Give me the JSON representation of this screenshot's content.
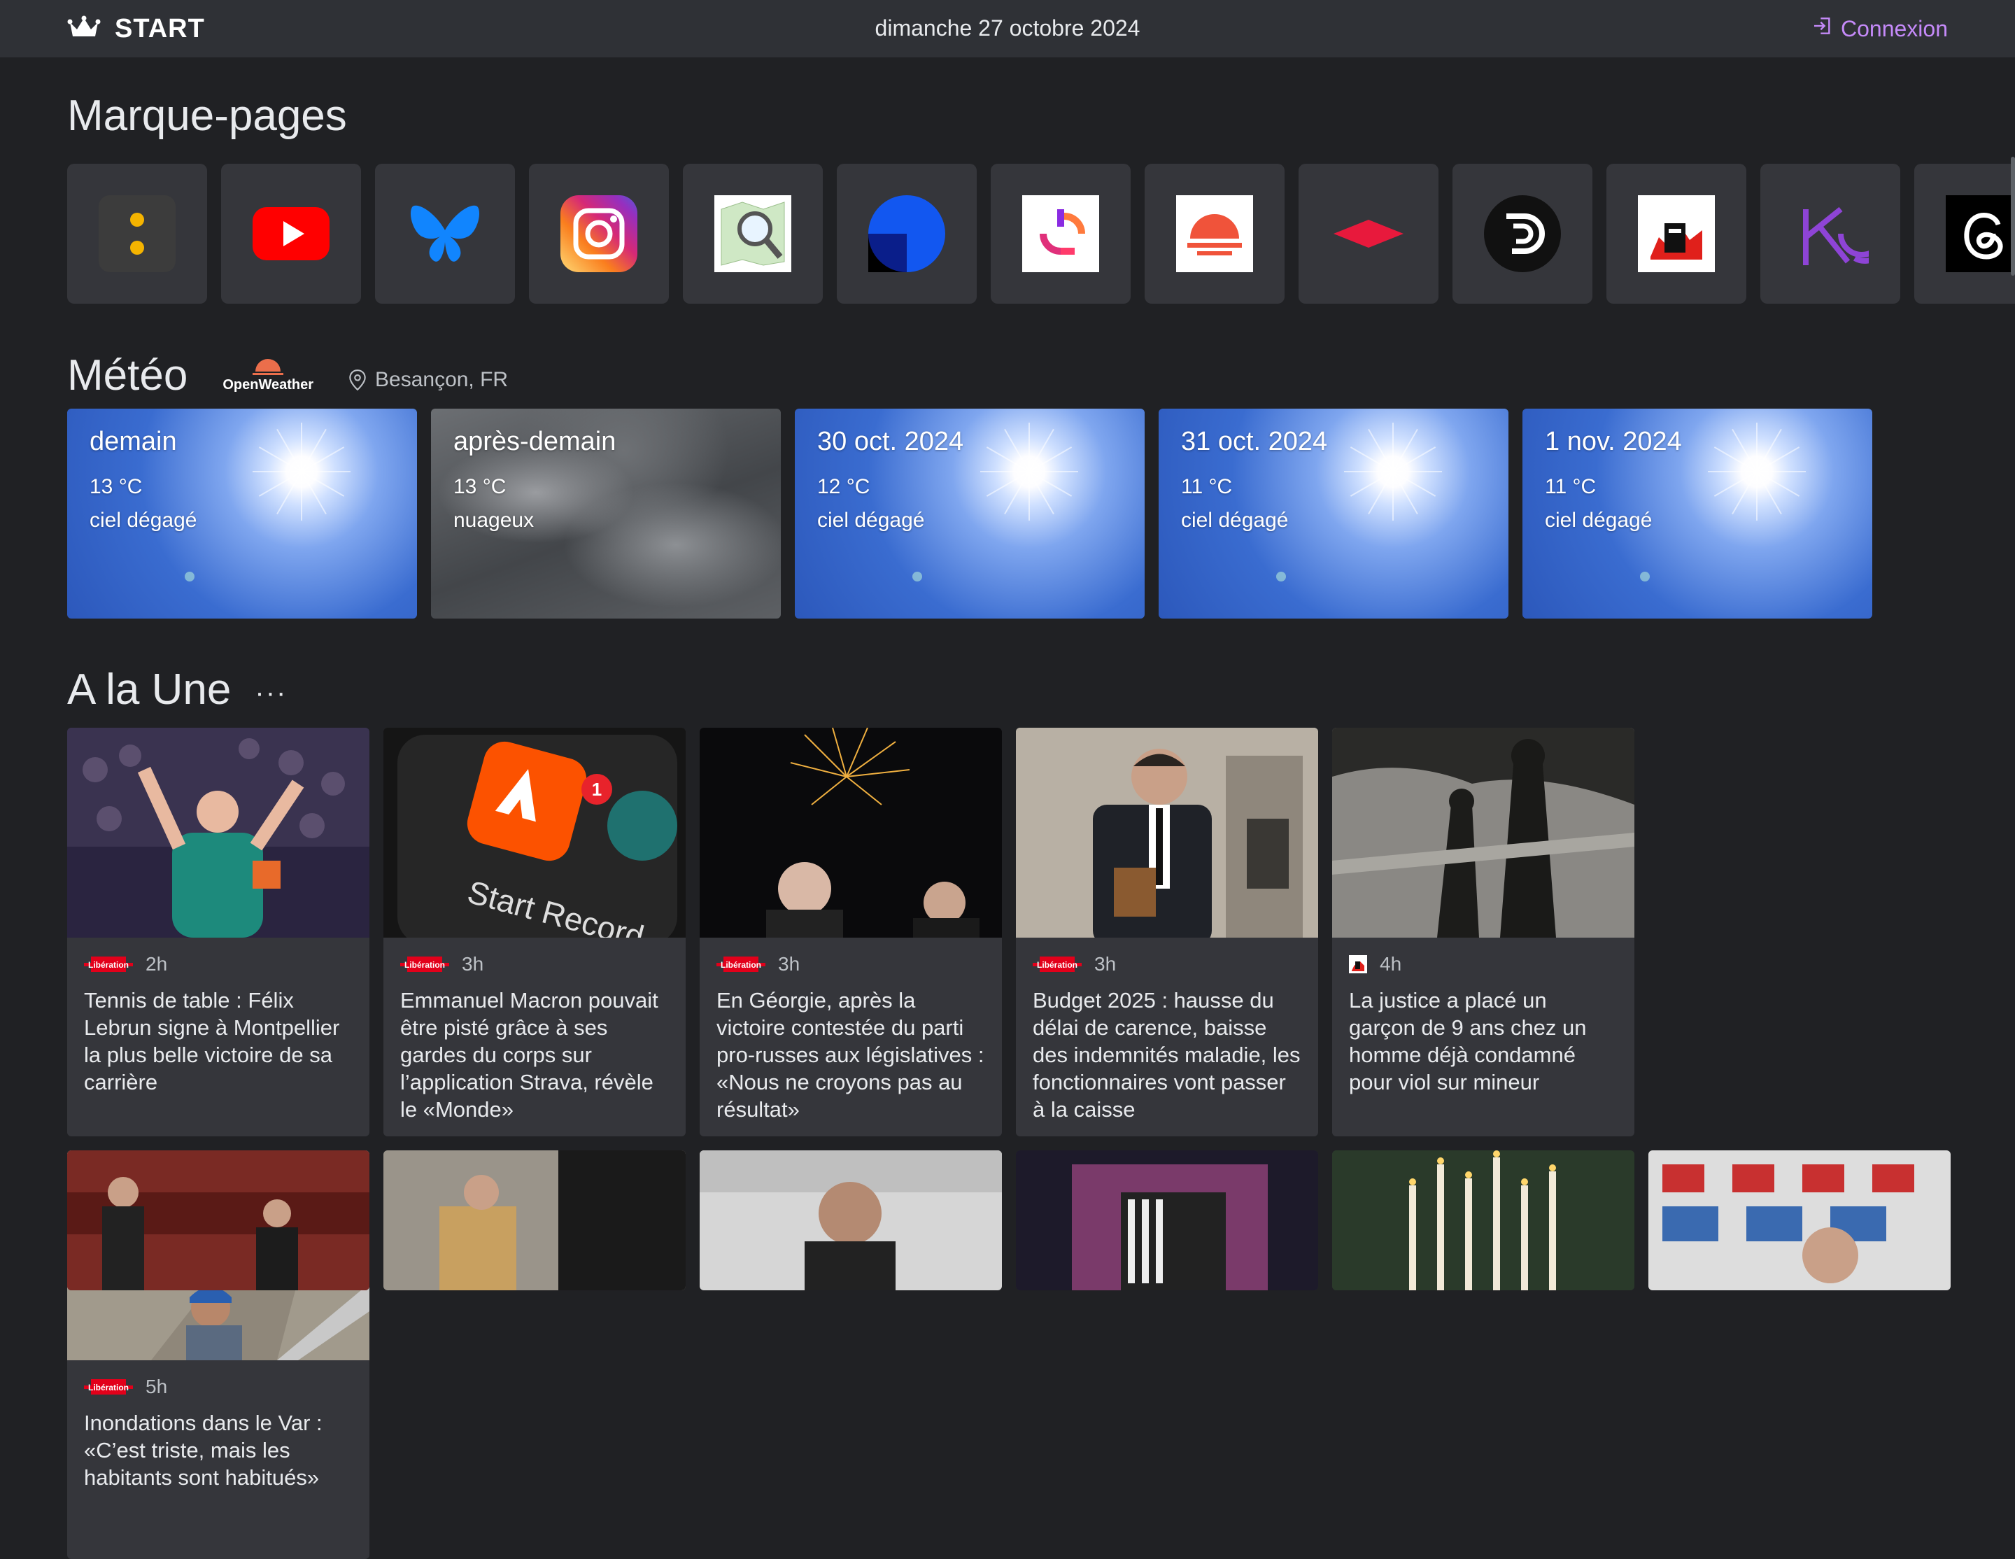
{
  "header": {
    "brand": "START",
    "brand_icon": "crown-icon",
    "date": "dimanche 27 octobre 2024",
    "login_label": "Connexion",
    "login_icon": "login-icon",
    "accent_color": "#c58af9"
  },
  "bookmarks": {
    "title": "Marque-pages",
    "items": [
      {
        "icon": "two-dots-app-icon"
      },
      {
        "icon": "youtube-icon"
      },
      {
        "icon": "bluesky-icon"
      },
      {
        "icon": "instagram-icon"
      },
      {
        "icon": "map-magnifier-icon"
      },
      {
        "icon": "blue-circle-app-icon"
      },
      {
        "icon": "colorful-swirl-app-icon"
      },
      {
        "icon": "sunset-app-icon"
      },
      {
        "icon": "red-diamond-icon"
      },
      {
        "icon": "d-logo-icon"
      },
      {
        "icon": "newspaper-logo-icon"
      },
      {
        "icon": "purple-k-logo-icon"
      },
      {
        "icon": "threads-icon"
      }
    ]
  },
  "weather": {
    "title": "Météo",
    "provider": "OpenWeather",
    "location": "Besançon, FR",
    "days": [
      {
        "day": "demain",
        "temp": "13 °C",
        "desc": "ciel dégagé",
        "kind": "sunny"
      },
      {
        "day": "après-demain",
        "temp": "13 °C",
        "desc": "nuageux",
        "kind": "cloudy"
      },
      {
        "day": "30 oct. 2024",
        "temp": "12 °C",
        "desc": "ciel dégagé",
        "kind": "sunny"
      },
      {
        "day": "31 oct. 2024",
        "temp": "11 °C",
        "desc": "ciel dégagé",
        "kind": "sunny"
      },
      {
        "day": "1 nov. 2024",
        "temp": "11 °C",
        "desc": "ciel dégagé",
        "kind": "sunny"
      }
    ]
  },
  "news": {
    "title": "A la Une",
    "more_label": "···",
    "articles": [
      {
        "source": "Libération",
        "time": "2h",
        "title": "Tennis de table : Félix Lebrun signe à Montpellier la plus belle victoire de sa carrière"
      },
      {
        "source": "Libération",
        "time": "3h",
        "title": "Emmanuel Macron pouvait être pisté grâce à ses gardes du corps sur l’application Strava, révèle le «Monde»"
      },
      {
        "source": "Libération",
        "time": "3h",
        "title": "En Géorgie, après la victoire contestée du parti pro-russes aux législatives : «Nous ne croyons pas au résultat»"
      },
      {
        "source": "Libération",
        "time": "3h",
        "title": "Budget 2025 : hausse du délai de carence, baisse des indemnités maladie, les fonctionnaires vont passer à la caisse"
      },
      {
        "source": "other",
        "time": "4h",
        "title": "La justice a placé un garçon de 9 ans chez un homme déjà condamné pour viol sur mineur"
      },
      {
        "source": "Libération",
        "time": "5h",
        "title": "Inondations dans le Var : «C’est triste, mais les habitants sont habitués»"
      }
    ]
  }
}
